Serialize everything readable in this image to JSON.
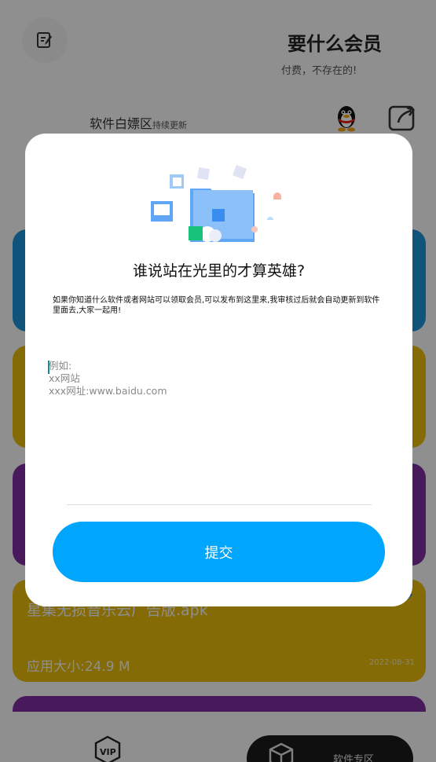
{
  "header": {
    "title": "要什么会员",
    "subtitle": "付费，不存在的!",
    "edit_icon": "edit-note-icon"
  },
  "section": {
    "title": "软件白嫖区",
    "tag": "持续更新",
    "qq_icon": "qq-penguin-icon",
    "share_icon": "share-icon"
  },
  "cards": [
    {
      "name": "",
      "size": "",
      "date": "",
      "color": "#1c8fd4"
    },
    {
      "name": "",
      "size": "",
      "date": "",
      "color": "#e3b80c"
    },
    {
      "name": "",
      "size": "",
      "date": "",
      "color": "#7d2e9f"
    },
    {
      "name": "星集无损音乐云广告版.apk",
      "size": "应用大小:24.9 M",
      "date": "2022-08-31",
      "color": "#e3b80c"
    },
    {
      "name": "",
      "size": "",
      "date": "",
      "color": "#7d2e9f"
    }
  ],
  "bottom_nav": {
    "vip_icon": "vip-icon",
    "software_icon": "cube-icon",
    "software_label": "软件专区"
  },
  "dialog": {
    "title": "谁说站在光里的才算英雄?",
    "description": "如果你知道什么软件或者网站可以领取会员,可以发布到这里来,我审核过后就会自动更新到软件里面去,大家一起用!",
    "input_placeholder": "例如:\nxx网站\nxxx网址:www.baidu.com",
    "submit_label": "提交",
    "accent": "#00a6fd"
  }
}
